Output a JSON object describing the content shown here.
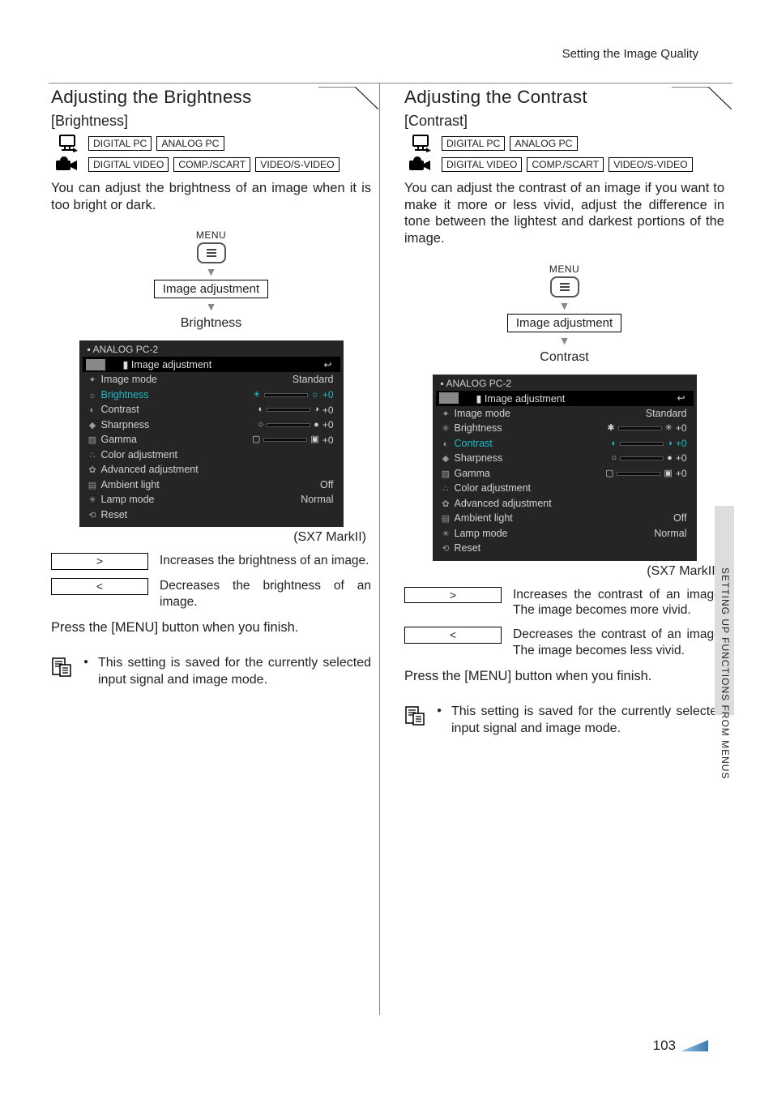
{
  "header": {
    "section": "Setting the Image Quality"
  },
  "sideTab": "SETTING UP FUNCTIONS FROM MENUS",
  "pageNumber": "103",
  "nav": {
    "menuLabel": "MENU",
    "level1": "Image adjustment"
  },
  "signalTags": {
    "digitalPc": "DIGITAL PC",
    "analogPc": "ANALOG PC",
    "digitalVideo": "DIGITAL VIDEO",
    "compScart": "COMP./SCART",
    "videoSvideo": "VIDEO/S-VIDEO"
  },
  "osd": {
    "source": "ANALOG PC-2",
    "tabLabel": "Image adjustment",
    "rows": {
      "imageMode": {
        "label": "Image mode",
        "value": "Standard"
      },
      "brightness": {
        "label": "Brightness",
        "value": "+0"
      },
      "contrast": {
        "label": "Contrast",
        "value": "+0"
      },
      "sharpness": {
        "label": "Sharpness",
        "value": "+0"
      },
      "gamma": {
        "label": "Gamma",
        "value": "+0"
      },
      "colorAdj": {
        "label": "Color adjustment"
      },
      "advAdj": {
        "label": "Advanced adjustment"
      },
      "ambient": {
        "label": "Ambient light",
        "value": "Off"
      },
      "lamp": {
        "label": "Lamp mode",
        "value": "Normal"
      },
      "reset": {
        "label": "Reset"
      }
    },
    "caption": "(SX7 MarkII)"
  },
  "keys": {
    "right": ">",
    "left": "<"
  },
  "common": {
    "finish": "Press the [MENU] button when you finish.",
    "note": "This setting is saved for the currently selected input signal and image mode."
  },
  "left": {
    "title": "Adjusting the Brightness",
    "label": "[Brightness]",
    "desc": "You can adjust the brightness of an image when it is too bright or dark.",
    "navItem": "Brightness",
    "incDesc": "Increases the brightness of an image.",
    "decDesc": "Decreases the brightness of an image."
  },
  "right": {
    "title": "Adjusting the Contrast",
    "label": "[Contrast]",
    "desc": "You can adjust the contrast of an image if you want to make it more or less vivid, adjust the difference in tone between the lightest and darkest portions of the image.",
    "navItem": "Contrast",
    "incDesc": "Increases the contrast of an image. The image becomes more vivid.",
    "decDesc": "Decreases the contrast of an image. The image becomes less vivid."
  }
}
